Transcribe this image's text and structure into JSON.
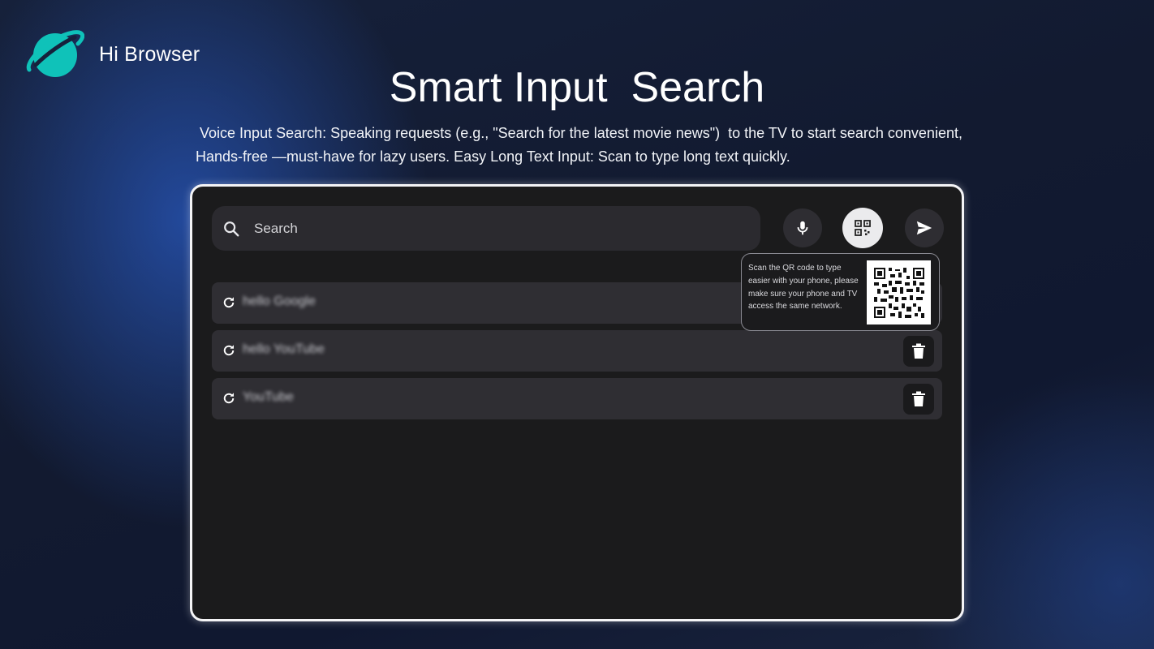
{
  "brand": {
    "name": "Hi Browser",
    "logo_icon": "planet-ring-icon",
    "logo_color": "#0fc2b9"
  },
  "hero": {
    "title": "Smart Input  Search",
    "description": " Voice Input Search: Speaking requests (e.g., \"Search for the latest movie news\")  to the TV to start search convenient, Hands-free —must-have for lazy users. Easy Long Text Input: Scan to type long text quickly."
  },
  "search": {
    "placeholder": "Search",
    "value": "",
    "icon": "search-icon"
  },
  "actions": {
    "mic_icon": "microphone-icon",
    "qr_icon": "qr-scan-icon",
    "send_icon": "send-icon"
  },
  "qr_popup": {
    "text": "Scan the QR code to type easier with your phone, please make sure your phone and TV access the same network."
  },
  "history": {
    "items": [
      {
        "label": "hello Google"
      },
      {
        "label": "hello YouTube"
      },
      {
        "label": "YouTube"
      }
    ],
    "item_icon": "refresh-icon",
    "delete_icon": "trash-icon"
  },
  "colors": {
    "panel_bg": "#1b1b1c",
    "panel_border": "#f4f4f6",
    "row_bg": "#2f2e33",
    "accent": "#0fc2b9"
  }
}
